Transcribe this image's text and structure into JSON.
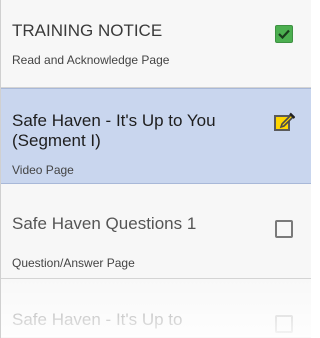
{
  "items": [
    {
      "title": "TRAINING NOTICE",
      "subtitle": "Read and Acknowledge Page",
      "status": "complete"
    },
    {
      "title": "Safe Haven - It's Up to You (Segment I)",
      "subtitle": "Video Page",
      "status": "in-progress"
    },
    {
      "title": "Safe Haven Questions 1",
      "subtitle": "Question/Answer Page",
      "status": "not-started"
    },
    {
      "title": "Safe Haven - It's Up to",
      "subtitle": "",
      "status": "not-started"
    }
  ],
  "colors": {
    "selected_bg": "#c9d6ee",
    "check_green": "#4caf50",
    "edit_yellow": "#ffd600"
  },
  "icons": {
    "complete": "checkmark-icon",
    "in_progress": "edit-icon",
    "not_started": "empty-checkbox-icon"
  }
}
